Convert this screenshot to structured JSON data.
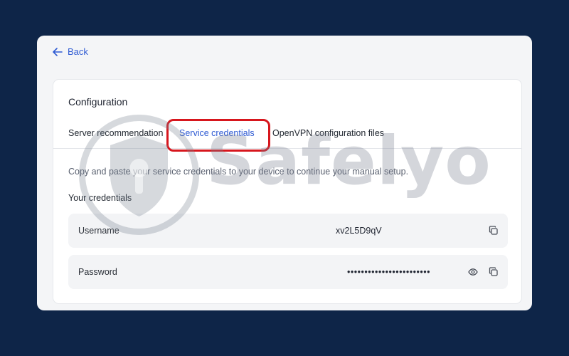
{
  "nav": {
    "back_label": "Back"
  },
  "card": {
    "title": "Configuration",
    "tabs": [
      {
        "label": "Server recommendation",
        "active": false
      },
      {
        "label": "Service credentials",
        "active": true
      },
      {
        "label": "OpenVPN configuration files",
        "active": false
      }
    ],
    "instruction": "Copy and paste your service credentials to your device to continue your manual setup.",
    "section_title": "Your credentials",
    "credentials": [
      {
        "label": "Username",
        "value": "xv2L5D9qV",
        "icons": [
          "copy-icon"
        ]
      },
      {
        "label": "Password",
        "value": "••••••••••••••••••••••••",
        "icons": [
          "eye-icon",
          "copy-icon"
        ]
      }
    ]
  },
  "watermark": {
    "text": "Safelyo"
  },
  "colors": {
    "background": "#0e2548",
    "accent": "#2f5bd3",
    "highlight": "#d7161d"
  }
}
